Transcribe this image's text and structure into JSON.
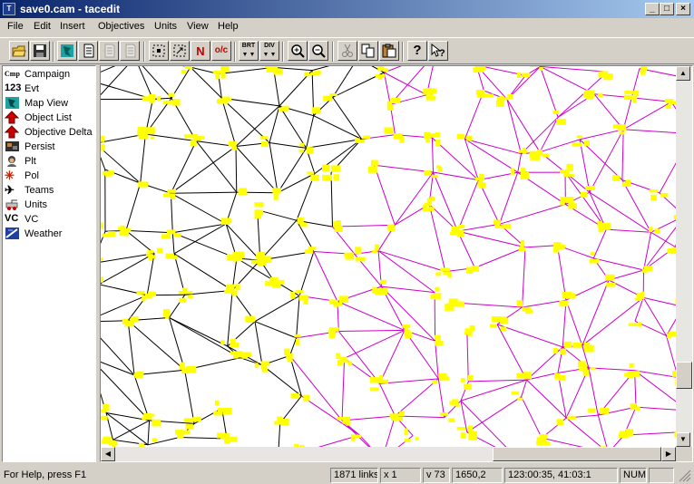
{
  "window": {
    "title": "save0.cam - tacedit",
    "icon": "app-icon"
  },
  "menu": [
    "File",
    "Edit",
    "Insert",
    "Objectives",
    "Units",
    "View",
    "Help"
  ],
  "toolbar": {
    "buttons": [
      {
        "name": "open-folder-icon"
      },
      {
        "name": "save-disk-icon"
      },
      {
        "name": "map-view-icon"
      },
      {
        "name": "document-icon"
      },
      {
        "name": "document-icon"
      },
      {
        "name": "document-icon"
      },
      {
        "name": "select-region-icon"
      },
      {
        "name": "select-region-icon"
      },
      {
        "name": "north-icon",
        "glyph": "N"
      },
      {
        "name": "oc-icon",
        "glyph": "o/c"
      },
      {
        "name": "brigade-icon",
        "glyph": "BRT"
      },
      {
        "name": "division-icon",
        "glyph": "DIV"
      },
      {
        "name": "zoom-in-icon"
      },
      {
        "name": "zoom-out-icon"
      },
      {
        "name": "cut-icon"
      },
      {
        "name": "copy-icon"
      },
      {
        "name": "paste-icon"
      },
      {
        "name": "help-icon"
      },
      {
        "name": "context-help-icon"
      }
    ]
  },
  "tree": [
    {
      "label": "Campaign",
      "icon": "campaign-icon",
      "glyph": "Cmp",
      "color": "#000000"
    },
    {
      "label": "Evt",
      "icon": "event-icon",
      "glyph": "123",
      "color": "#000000"
    },
    {
      "label": "Map View",
      "icon": "map-view-icon",
      "glyph": "",
      "color": "#008080"
    },
    {
      "label": "Object List",
      "icon": "red-arrow-icon",
      "glyph": "",
      "color": "#cc0000"
    },
    {
      "label": "Objective Delta",
      "icon": "red-arrow-icon",
      "glyph": "",
      "color": "#cc0000"
    },
    {
      "label": "Persist",
      "icon": "persist-icon",
      "glyph": "",
      "color": "#000000"
    },
    {
      "label": "Plt",
      "icon": "pilot-icon",
      "glyph": "",
      "color": "#000000"
    },
    {
      "label": "Pol",
      "icon": "star-icon",
      "glyph": "✳",
      "color": "#cc2200"
    },
    {
      "label": "Teams",
      "icon": "aircraft-icon",
      "glyph": "✈",
      "color": "#000000"
    },
    {
      "label": "Units",
      "icon": "units-icon",
      "glyph": "",
      "color": "#cc0000"
    },
    {
      "label": "VC",
      "icon": "vc-icon",
      "glyph": "VC",
      "color": "#000000"
    },
    {
      "label": "Weather",
      "icon": "weather-icon",
      "glyph": "",
      "color": "#2040a0"
    }
  ],
  "map": {
    "black_network": "#000000",
    "pink_network": "#cc00cc",
    "objective_color": "#ffff00"
  },
  "status": {
    "help": "For Help, press F1",
    "links": "1871 links",
    "zoom": "x 1",
    "version": "v 73",
    "coords": "1650,2",
    "time": "123:00:35, 41:03:1",
    "num": "NUM"
  },
  "colors": {
    "title_start": "#0a246a",
    "title_end": "#a6caf0",
    "face": "#d4d0c8"
  }
}
